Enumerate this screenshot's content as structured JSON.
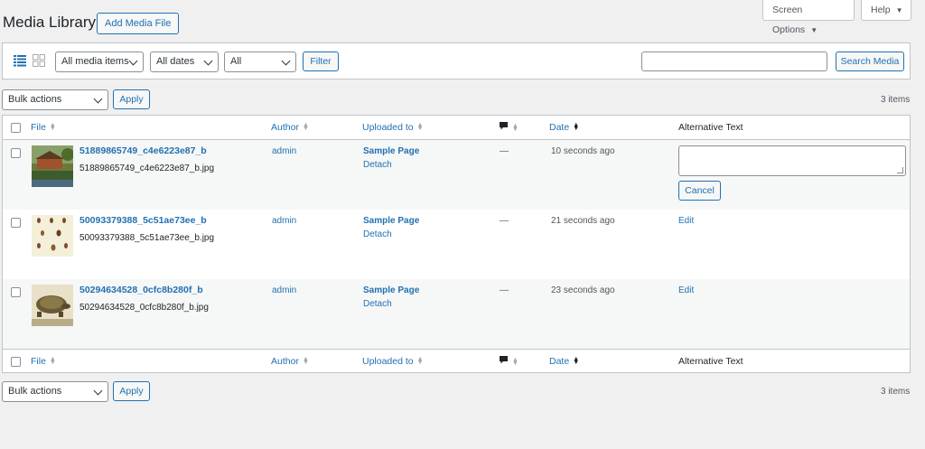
{
  "header": {
    "title": "Media Library",
    "add_button": "Add Media File",
    "screen_options": "Screen Options",
    "help": "Help"
  },
  "filters": {
    "media_type": "All media items",
    "dates": "All dates",
    "third": "All",
    "filter_button": "Filter",
    "search_button": "Search Media",
    "search_value": ""
  },
  "bulk": {
    "label": "Bulk actions",
    "apply": "Apply",
    "count": "3 items"
  },
  "columns": {
    "file": "File",
    "author": "Author",
    "uploaded_to": "Uploaded to",
    "date": "Date",
    "alt_text": "Alternative Text"
  },
  "rows": [
    {
      "title": "51889865749_c4e6223e87_b",
      "filename": "51889865749_c4e6223e87_b.jpg",
      "author": "admin",
      "uploaded_to": "Sample Page",
      "detach": "Detach",
      "comments": "—",
      "date": "10 seconds ago",
      "alt_action": "Cancel"
    },
    {
      "title": "50093379388_5c51ae73ee_b",
      "filename": "50093379388_5c51ae73ee_b.jpg",
      "author": "admin",
      "uploaded_to": "Sample Page",
      "detach": "Detach",
      "comments": "—",
      "date": "21 seconds ago",
      "alt_action": "Edit"
    },
    {
      "title": "50294634528_0cfc8b280f_b",
      "filename": "50294634528_0cfc8b280f_b.jpg",
      "author": "admin",
      "uploaded_to": "Sample Page",
      "detach": "Detach",
      "comments": "—",
      "date": "23 seconds ago",
      "alt_action": "Edit"
    }
  ],
  "colors": {
    "accent": "#2271b1",
    "background": "#f0f0f1",
    "border": "#c3c4c7"
  }
}
